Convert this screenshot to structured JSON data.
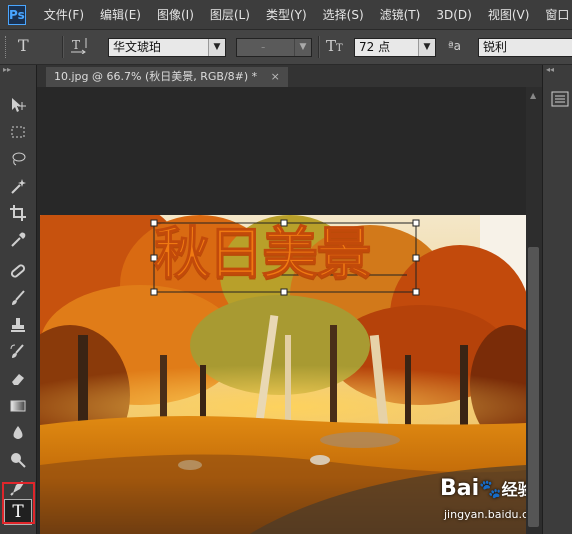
{
  "app": {
    "logo": "Ps"
  },
  "menu": [
    "文件(F)",
    "编辑(E)",
    "图像(I)",
    "图层(L)",
    "类型(Y)",
    "选择(S)",
    "滤镜(T)",
    "3D(D)",
    "视图(V)",
    "窗口"
  ],
  "options": {
    "font_family": "华文琥珀",
    "font_style": "-",
    "font_size": "72 点",
    "aa_icon_text": "ªa",
    "antialias": "锐利"
  },
  "document": {
    "tab_title": "10.jpg @ 66.7% (秋日美景, RGB/8#) *",
    "close_glyph": "×"
  },
  "canvas_text": "秋日美景",
  "watermark": {
    "brand": "Bai",
    "brand_suffix": "经验",
    "url": "jingyan.baidu.com"
  },
  "colors": {
    "accent_ps": "#4aa6ff",
    "highlight": "#e0262b",
    "text_fill": "#f07a12"
  }
}
